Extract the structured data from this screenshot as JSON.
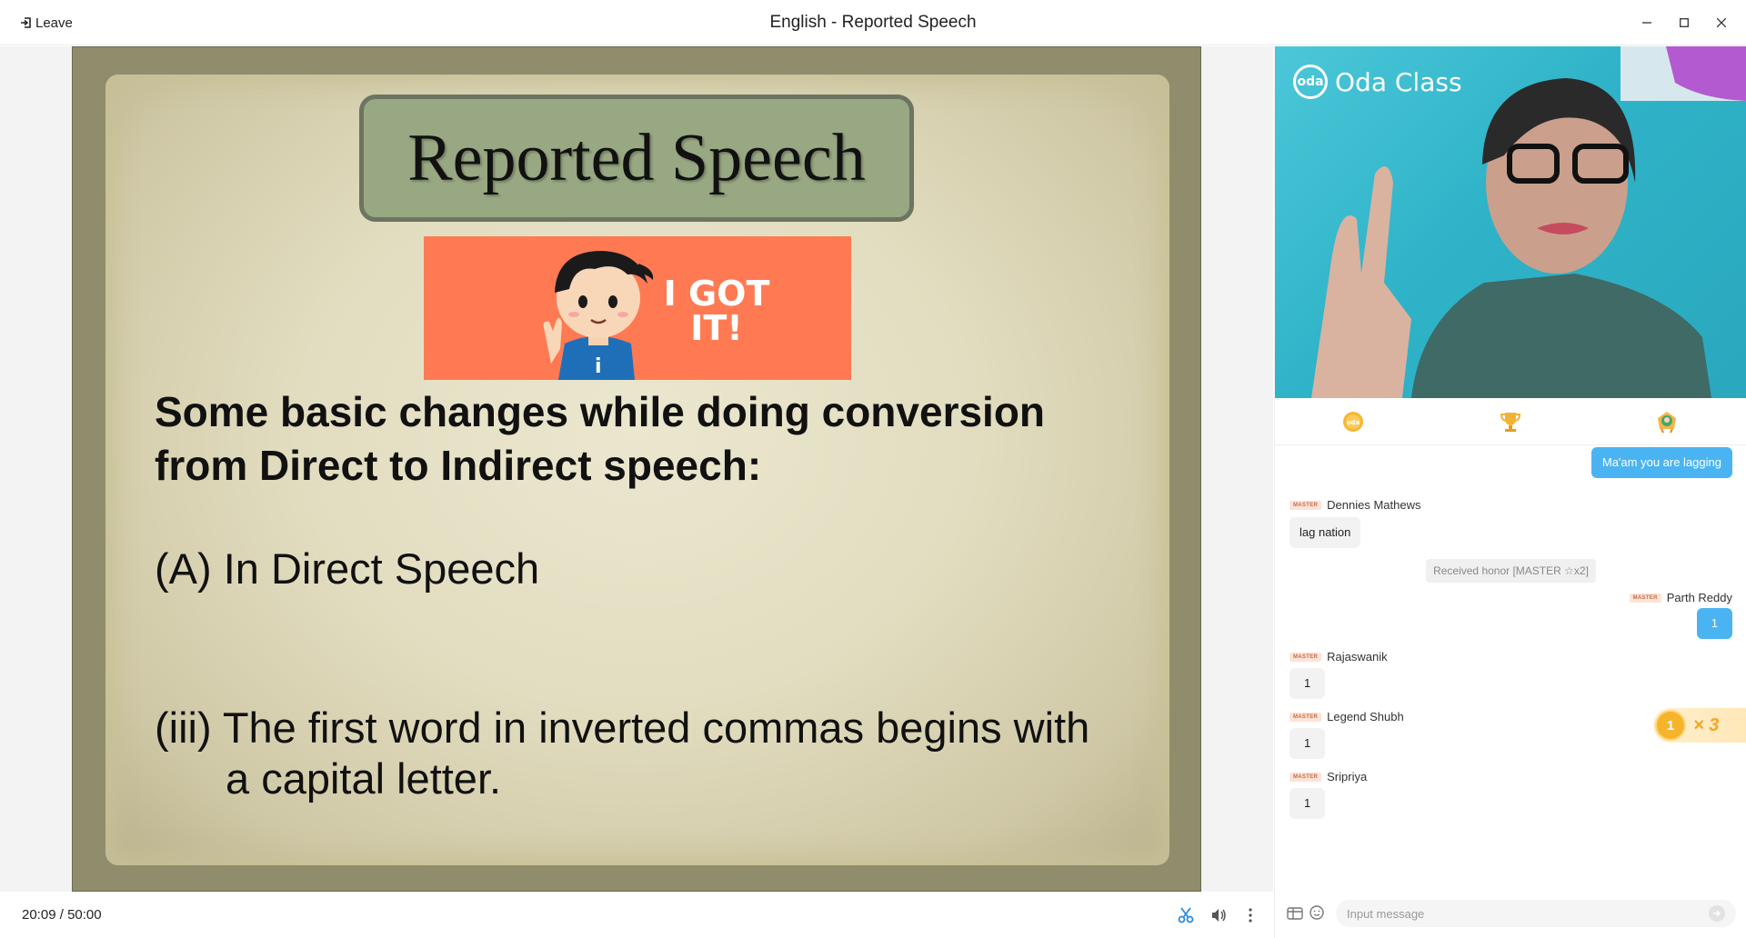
{
  "window": {
    "title": "English - Reported Speech",
    "leave_label": "Leave"
  },
  "slide": {
    "title": "Reported Speech",
    "banner_text": "I GOT IT!",
    "heading": "Some basic changes while doing conversion from Direct to Indirect speech:",
    "point_a": "(A) In Direct Speech",
    "point_iii_line1": "(iii) The first word in inverted commas begins with",
    "point_iii_line2": "a capital letter."
  },
  "player": {
    "elapsed": "20:09",
    "separator": "/",
    "duration": "50:00"
  },
  "video": {
    "brand": "Oda Class",
    "brand_mark": "oda"
  },
  "chat": {
    "messages": [
      {
        "type": "mine",
        "text": "Ma'am you are lagging"
      },
      {
        "type": "other",
        "badge": "MASTER",
        "sender": "Dennies Mathews",
        "text": "lag nation"
      },
      {
        "type": "system",
        "text": "Received honor [MASTER ☆x2]"
      },
      {
        "type": "mine",
        "badge": "MASTER",
        "sender": "Parth Reddy",
        "text": "1"
      },
      {
        "type": "other",
        "badge": "MASTER",
        "sender": "Rajaswanik",
        "text": "1"
      },
      {
        "type": "other",
        "badge": "MASTER",
        "sender": "Legend Shubh",
        "text": "1"
      },
      {
        "type": "other",
        "badge": "MASTER",
        "sender": "Sripriya",
        "text": "1"
      }
    ],
    "combo": {
      "count": "1",
      "multiplier": "× 3"
    },
    "input_placeholder": "Input message"
  },
  "colors": {
    "accent": "#4ab4f3",
    "slide_title_box": "#98a882",
    "banner": "#ff7a52",
    "badge_text": "#c96b44"
  },
  "icons": {
    "leave": "exit-icon",
    "minimize": "minimize-icon",
    "maximize": "maximize-icon",
    "close": "close-icon",
    "scissors": "scissors-icon",
    "volume": "volume-icon",
    "more": "more-vertical-icon",
    "coin_tab": "coin-icon",
    "trophy_tab": "trophy-icon",
    "medal_tab": "medal-icon",
    "gift": "gift-icon",
    "emoji": "emoji-icon",
    "send": "send-icon"
  }
}
